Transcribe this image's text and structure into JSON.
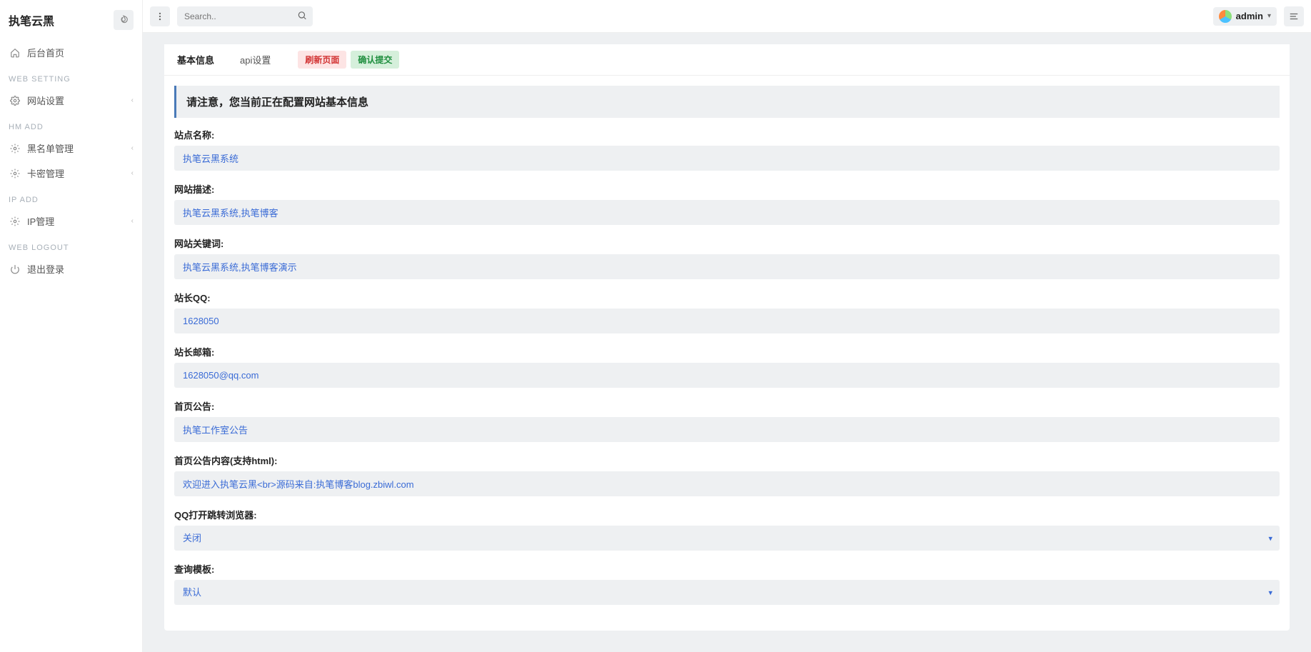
{
  "brand": {
    "title": "执笔云黑"
  },
  "search": {
    "placeholder": "Search.."
  },
  "user": {
    "name": "admin"
  },
  "sidebar": {
    "home_label": "后台首页",
    "groups": [
      {
        "title": "WEB SETTING",
        "items": [
          {
            "label": "网站设置",
            "icon": "gear",
            "expandable": true
          }
        ]
      },
      {
        "title": "HM ADD",
        "items": [
          {
            "label": "黑名单管理",
            "icon": "gear",
            "expandable": true
          },
          {
            "label": "卡密管理",
            "icon": "gear",
            "expandable": true
          }
        ]
      },
      {
        "title": "IP ADD",
        "items": [
          {
            "label": "IP管理",
            "icon": "gear",
            "expandable": true
          }
        ]
      },
      {
        "title": "WEB LOGOUT",
        "items": [
          {
            "label": "退出登录",
            "icon": "power",
            "expandable": false
          }
        ]
      }
    ]
  },
  "tabs": {
    "items": [
      {
        "label": "基本信息",
        "active": true
      },
      {
        "label": "api设置",
        "active": false
      }
    ],
    "actions": {
      "refresh": "刷新页面",
      "submit": "确认提交"
    }
  },
  "notice": "请注意，您当前正在配置网站基本信息",
  "form": {
    "site_name": {
      "label": "站点名称:",
      "value": "执笔云黑系统"
    },
    "site_desc": {
      "label": "网站描述:",
      "value": "执笔云黑系统,执笔博客"
    },
    "site_keywords": {
      "label": "网站关键词:",
      "value": "执笔云黑系统,执笔博客演示"
    },
    "admin_qq": {
      "label": "站长QQ:",
      "value": "1628050"
    },
    "admin_email": {
      "label": "站长邮箱:",
      "value": "1628050@qq.com"
    },
    "home_notice": {
      "label": "首页公告:",
      "value": "执笔工作室公告"
    },
    "home_notice_content": {
      "label": "首页公告内容(支持html):",
      "value": "欢迎进入执笔云黑<br>源码来自:执笔博客blog.zbiwl.com"
    },
    "qq_jump": {
      "label": "QQ打开跳转浏览器:",
      "value": "关闭"
    },
    "query_tpl": {
      "label": "查询模板:",
      "value": "默认"
    }
  }
}
